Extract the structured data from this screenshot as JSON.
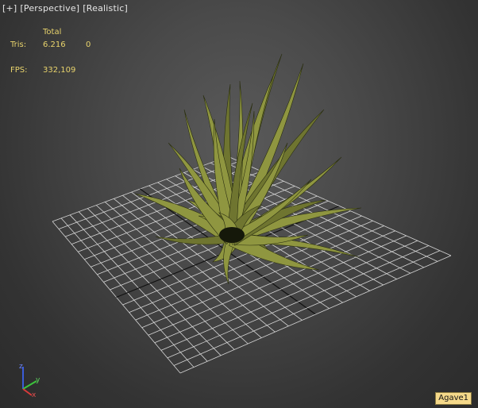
{
  "viewport": {
    "labels": [
      "[+]",
      "[Perspective]",
      "[Realistic]"
    ]
  },
  "stats": {
    "header": "Total",
    "tris_label": "Tris:",
    "tris_value": "6.216",
    "tris_selected": "0",
    "fps_label": "FPS:",
    "fps_value": "332,109"
  },
  "axis_gizmo": {
    "x": "x",
    "y": "y",
    "z": "z"
  },
  "selected_object": "Agave1",
  "colors": {
    "stats_text": "#e8d36c",
    "grid_line": "#d6d6d6",
    "leaf": "#8f9640",
    "object_label_bg": "#f5d98a"
  }
}
